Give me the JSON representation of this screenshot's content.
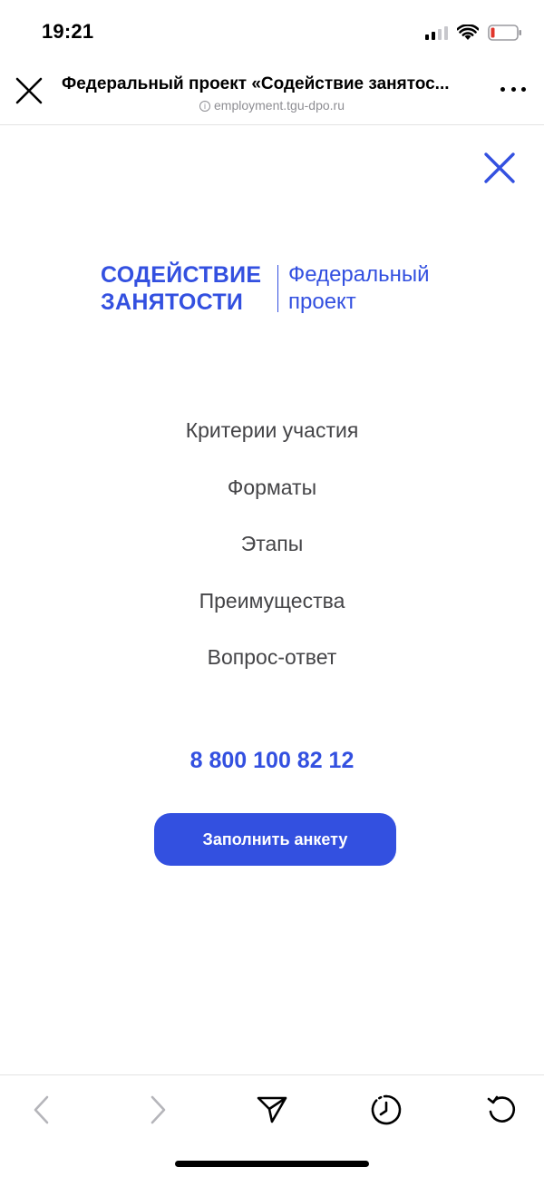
{
  "status_bar": {
    "time": "19:21",
    "icons": [
      "cellular-signal-icon",
      "wifi-icon",
      "battery-low-icon"
    ]
  },
  "browser": {
    "title": "Федеральный проект «Содействие занятос...",
    "url": "employment.tgu-dpo.ru",
    "icons": [
      "close-icon",
      "info-icon",
      "more-icon"
    ]
  },
  "logo": {
    "line1": "СОДЕЙСТВИЕ",
    "line2": "ЗАНЯТОСТИ",
    "right1": "Федеральный",
    "right2": "проект"
  },
  "nav": {
    "items": [
      {
        "label": "Критерии участия"
      },
      {
        "label": "Форматы"
      },
      {
        "label": "Этапы"
      },
      {
        "label": "Преимущества"
      },
      {
        "label": "Вопрос-ответ"
      }
    ]
  },
  "contact": {
    "phone": "8 800 100 82 12"
  },
  "cta": {
    "label": "Заполнить анкету"
  },
  "toolbar": {
    "icons": [
      "back-icon",
      "forward-icon",
      "share-icon",
      "history-icon",
      "reload-icon"
    ]
  },
  "colors": {
    "brand": "#3350e0",
    "menu_text": "#444447",
    "muted": "#8e8e93",
    "battery_low": "#e0352b"
  }
}
